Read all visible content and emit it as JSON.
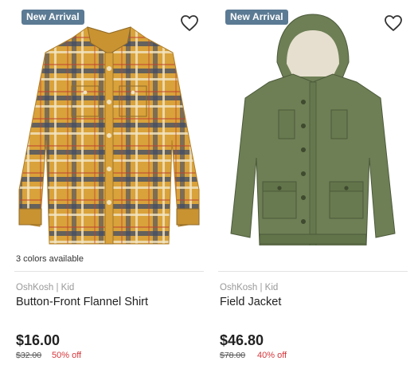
{
  "products": [
    {
      "badge": "New Arrival",
      "colors_available": "3 colors available",
      "brand": "OshKosh | Kid",
      "name": "Button-Front Flannel Shirt",
      "price": "$16.00",
      "original_price": "$32.00",
      "discount": "50% off",
      "image": "plaid-flannel-shirt-image",
      "favorite_icon": "heart-outline-icon"
    },
    {
      "badge": "New Arrival",
      "colors_available": "",
      "brand": "OshKosh | Kid",
      "name": "Field Jacket",
      "price": "$46.80",
      "original_price": "$78.00",
      "discount": "40% off",
      "image": "olive-field-jacket-image",
      "favorite_icon": "heart-outline-icon"
    }
  ],
  "colors": {
    "badge_bg": "#5b7a93",
    "discount_red": "#d6363b",
    "shirt_mustard": "#d9a23a",
    "jacket_olive": "#6e7f55"
  }
}
